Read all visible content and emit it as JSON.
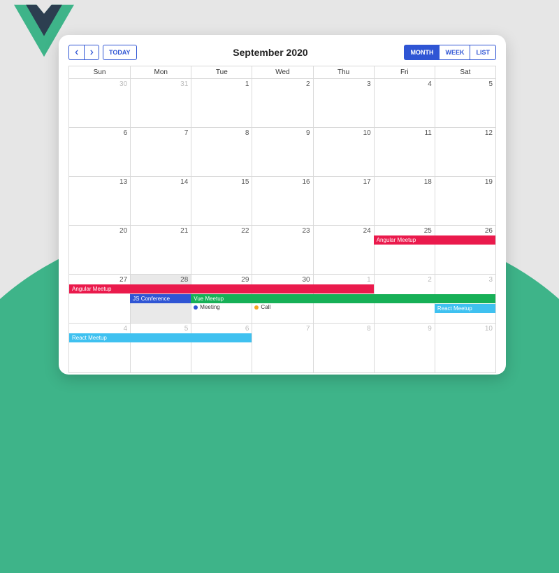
{
  "header": {
    "title": "September 2020",
    "today_label": "TODAY",
    "views": {
      "month": "MONTH",
      "week": "WEEK",
      "list": "LIST"
    }
  },
  "day_names": [
    "Sun",
    "Mon",
    "Tue",
    "Wed",
    "Thu",
    "Fri",
    "Sat"
  ],
  "weeks": [
    {
      "days": [
        {
          "n": "30",
          "o": true
        },
        {
          "n": "31",
          "o": true
        },
        {
          "n": "1"
        },
        {
          "n": "2"
        },
        {
          "n": "3"
        },
        {
          "n": "4"
        },
        {
          "n": "5"
        }
      ]
    },
    {
      "days": [
        {
          "n": "6"
        },
        {
          "n": "7"
        },
        {
          "n": "8"
        },
        {
          "n": "9"
        },
        {
          "n": "10"
        },
        {
          "n": "11"
        },
        {
          "n": "12"
        }
      ]
    },
    {
      "days": [
        {
          "n": "13"
        },
        {
          "n": "14"
        },
        {
          "n": "15"
        },
        {
          "n": "16"
        },
        {
          "n": "17"
        },
        {
          "n": "18"
        },
        {
          "n": "19"
        }
      ]
    },
    {
      "days": [
        {
          "n": "20"
        },
        {
          "n": "21"
        },
        {
          "n": "22"
        },
        {
          "n": "23"
        },
        {
          "n": "24"
        },
        {
          "n": "25"
        },
        {
          "n": "26"
        }
      ]
    },
    {
      "days": [
        {
          "n": "27"
        },
        {
          "n": "28",
          "t": true
        },
        {
          "n": "29"
        },
        {
          "n": "30"
        },
        {
          "n": "1",
          "o": true
        },
        {
          "n": "2",
          "o": true
        },
        {
          "n": "3",
          "o": true
        }
      ]
    },
    {
      "days": [
        {
          "n": "4",
          "o": true
        },
        {
          "n": "5",
          "o": true
        },
        {
          "n": "6",
          "o": true
        },
        {
          "n": "7",
          "o": true
        },
        {
          "n": "8",
          "o": true
        },
        {
          "n": "9",
          "o": true
        },
        {
          "n": "10",
          "o": true
        }
      ]
    }
  ],
  "events": {
    "angular1": "Angular Meetup",
    "angular2": "Angular Meetup",
    "jsconf": "JS Conference",
    "vue": "Vue Meetup",
    "meeting": "Meeting",
    "call": "Call",
    "react1": "React Meetup",
    "react2": "React Meetup"
  },
  "colors": {
    "red": "#ea1a4c",
    "blue": "#2f55d4",
    "sky": "#3fc1f0",
    "green": "#17b057"
  }
}
